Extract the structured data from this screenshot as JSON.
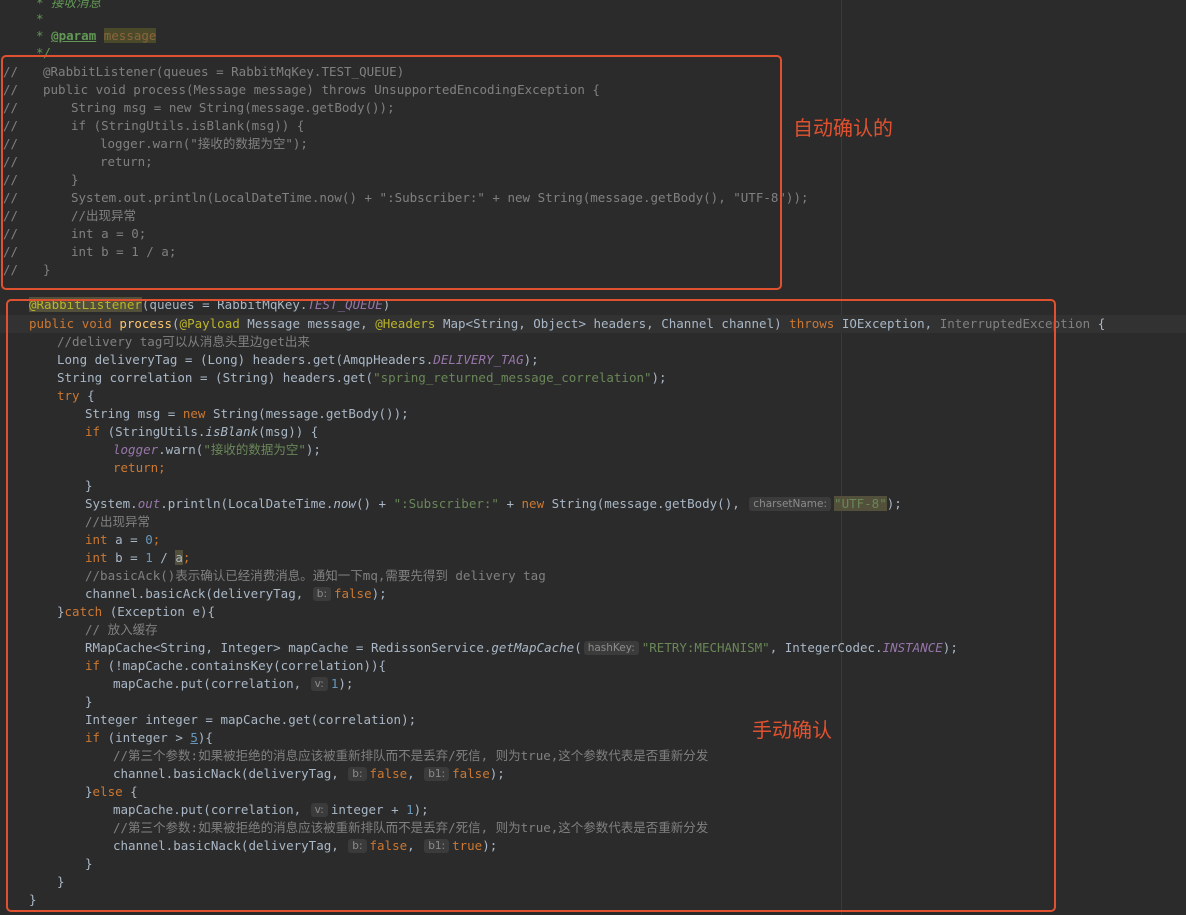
{
  "annotations": {
    "auto_ack_label": "自动确认的",
    "manual_ack_label": "手动确认"
  },
  "colors": {
    "background": "#2b2b2b",
    "keyword": "#cc7832",
    "annotation": "#bbb529",
    "string": "#6a8759",
    "number": "#6897bb",
    "comment": "#808080",
    "method": "#ffc66d",
    "static_field": "#9876aa",
    "annotation_box": "#e0522f"
  },
  "javadoc": {
    "l1": "* 接收消息",
    "l2": "*",
    "l3_star": "* ",
    "l3_tag": "@param",
    "l3_val": "message",
    "l4": "*/"
  },
  "commented_block": {
    "gutter": "//",
    "l1": "@RabbitListener(queues = RabbitMqKey.TEST_QUEUE)",
    "l2": "public void process(Message message) throws UnsupportedEncodingException {",
    "l3": "String msg = new String(message.getBody());",
    "l4": "if (StringUtils.isBlank(msg)) {",
    "l5": "logger.warn(\"接收的数据为空\");",
    "l6": "return;",
    "l7": "}",
    "l8": "System.out.println(LocalDateTime.now() + \":Subscriber:\" + new String(message.getBody(), \"UTF-8\"));",
    "l9": "//出现异常",
    "l10": "int a = 0;",
    "l11": "int b = 1 / a;",
    "l12": "}"
  },
  "code": {
    "ann_listener": "@RabbitListener",
    "p_open": "(",
    "queues": "queues = RabbitMqKey.",
    "test_queue": "TEST_QUEUE",
    "p_close": ")",
    "public": "public",
    "void": "void",
    "process": "process",
    "ann_payload": "@Payload",
    "message_param": " Message message, ",
    "ann_headers": "@Headers",
    "headers_param": " Map<String, Object> headers, Channel channel) ",
    "throws": "throws",
    "exc1": " IOException, ",
    "exc2": "InterruptedException",
    "open_brace": " {",
    "cmt_delivery": "//delivery tag可以从消息头里边get出来",
    "l_long": "Long deliveryTag = (Long) headers.get(AmqpHeaders.",
    "delivery_tag": "DELIVERY_TAG",
    "end_paren_semi": ");",
    "l_corr": "String correlation = (String) headers.get(",
    "str_corr": "\"spring_returned_message_correlation\"",
    "try": "try",
    "str_msg_a": "String msg = ",
    "new": "new",
    "str_msg_b": " String(message.getBody());",
    "if": "if",
    "if_blank_a": " (StringUtils.",
    "is_blank": "isBlank",
    "if_blank_b": "(msg)) {",
    "logger": "logger",
    "warn_a": ".warn(",
    "str_empty": "\"接收的数据为空\"",
    "return": "return",
    "semi": ";",
    "close_brace": "}",
    "sys_a": "System.",
    "out": "out",
    "sys_b": ".println(LocalDateTime.",
    "now": "now",
    "sys_c": "() + ",
    "str_sub": "\":Subscriber:\"",
    "plus": " + ",
    "sys_d": " String(message.getBody(), ",
    "hint_charset": "charsetName:",
    "str_utf8": "\"UTF-8\"",
    "cmt_exc": "//出现异常",
    "int": "int",
    "a_eq": " a = ",
    "zero": "0",
    "b_eq": " b = ",
    "one": "1",
    "div": " / ",
    "var_a": "a",
    "cmt_ack": "//basicAck()表示确认已经消费消息。通知一下mq,需要先得到 delivery tag",
    "ack_a": "channel.basicAck(deliveryTag, ",
    "hint_b": "b:",
    "false": "false",
    "catch_close": "}",
    "catch": "catch",
    "catch_b": " (Exception e){",
    "cmt_cache": "// 放入缓存",
    "rmap_a": "RMapCache<String, Integer> mapCache = RedissonService.",
    "get_map_cache": "getMapCache",
    "hint_hashkey": "hashKey:",
    "str_retry": "\"RETRY:MECHANISM\"",
    "rmap_b": ", IntegerCodec.",
    "instance": "INSTANCE",
    "if_contains": " (!mapCache.containsKey(correlation)){",
    "put_a": "mapCache.put(correlation, ",
    "hint_v": "v:",
    "integer_line": "Integer integer = mapCache.get(correlation);",
    "if_gt": " (integer > ",
    "five": "5",
    "if_gt_b": "){",
    "cmt_nack": "//第三个参数:如果被拒绝的消息应该被重新排队而不是丢弃/死信, 则为true,这个参数代表是否重新分发",
    "nack_a": "channel.basicNack(deliveryTag, ",
    "comma": ", ",
    "hint_b1": "b1:",
    "true": "true",
    "else": "else",
    "else_b": " {",
    "put_inc": "integer + ",
    "method_close": "}"
  }
}
